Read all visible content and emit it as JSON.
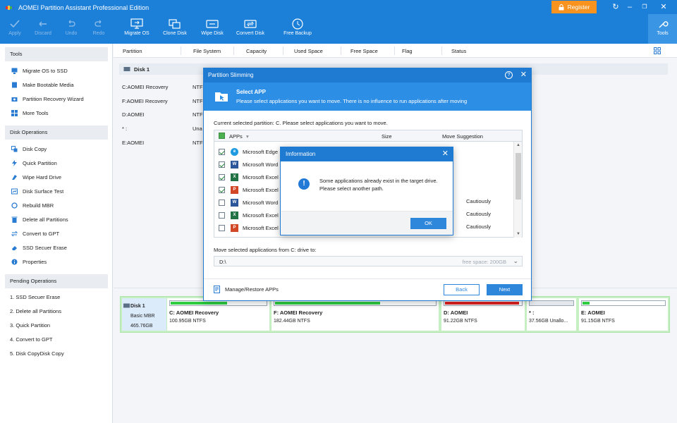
{
  "app": {
    "title": "AOMEI Partition Assistant Professional Edition",
    "register_label": "Register"
  },
  "toolbar": [
    {
      "label": "Apply",
      "icon": "check-icon"
    },
    {
      "label": "Discard",
      "icon": "discard-icon"
    },
    {
      "label": "Undo",
      "icon": "undo-icon"
    },
    {
      "label": "Redo",
      "icon": "redo-icon"
    },
    {
      "label": "Migrate OS",
      "icon": "migrate-os-icon"
    },
    {
      "label": "Clone Disk",
      "icon": "clone-disk-icon"
    },
    {
      "label": "Wipe Disk",
      "icon": "wipe-disk-icon"
    },
    {
      "label": "Convert Disk",
      "icon": "convert-disk-icon"
    },
    {
      "label": "Free Backup",
      "icon": "free-backup-icon"
    },
    {
      "label": "Tools",
      "icon": "wrench-icon"
    }
  ],
  "sidebar": {
    "tools_title": "Tools",
    "tools": [
      "Migrate OS to SSD",
      "Make Bootable Media",
      "Partition Recovery Wizard",
      "More Tools"
    ],
    "disk_ops_title": "Disk Operations",
    "disk_ops": [
      "Disk Copy",
      "Quick Partition",
      "Wipe Hard Drive",
      "Disk Surface Test",
      "Rebuild MBR",
      "Delete all Partitions",
      "Convert to GPT",
      "SSD Secuer Erase",
      "Properties"
    ],
    "pending_title": "Pending Operations",
    "pending": [
      "1. SSD Secuer Erase",
      "2. Delete all Partitions",
      "3. Quick Partition",
      "4. Convert to GPT",
      "5. Disk CopyDisk Copy"
    ]
  },
  "table": {
    "columns": [
      "Partition",
      "File System",
      "Capacity",
      "Used Space",
      "Free Space",
      "Flag",
      "Status"
    ],
    "disk_label": "Disk 1",
    "rows": [
      {
        "partition": "C:AOMEI Recovery",
        "fs": "NTF"
      },
      {
        "partition": "F:AOMEI Recovery",
        "fs": "NTF"
      },
      {
        "partition": "D:AOMEI",
        "fs": "NTF"
      },
      {
        "partition": "* :",
        "fs": "Una"
      },
      {
        "partition": "E:AOMEI",
        "fs": "NTF"
      }
    ]
  },
  "diskmap": {
    "name": "Disk 1",
    "type": "Basic MBR",
    "size": "465.76GB",
    "partitions": [
      {
        "name": "C: AOMEI Recovery",
        "detail": "100.95GB NTFS",
        "used": 0.6,
        "color": "#2ecc40"
      },
      {
        "name": "F: AOMEI Recovery",
        "detail": "182.44GB NTFS",
        "used": 0.66,
        "color": "#2ecc40"
      },
      {
        "name": "D: AOMEI",
        "detail": "91.22GB NTFS",
        "used": 0.97,
        "color": "#e02020"
      },
      {
        "name": "* :",
        "detail": "37.56GB Unallo...",
        "used": 0,
        "color": "#d9dde2"
      },
      {
        "name": "E: AOMEI",
        "detail": "91.15GB NTFS",
        "used": 0.1,
        "color": "#2ecc40"
      }
    ]
  },
  "slimming": {
    "title": "Partition Slimming",
    "banner_title": "Select APP",
    "banner_sub": "Please select applications you want to move. There is no influence to run applications after moving",
    "current": "Current selected partition: C. Please select applications you want to move.",
    "col_apps": "APPs",
    "col_size": "Size",
    "col_move": "Move Suggestion",
    "apps": [
      {
        "name": "Microsoft Edge",
        "checked": true,
        "icon": "edge-icon",
        "suggest": ""
      },
      {
        "name": "Microsoft Word",
        "checked": true,
        "icon": "word-icon",
        "suggest": ""
      },
      {
        "name": "Microsoft Excel",
        "checked": true,
        "icon": "excel-icon",
        "suggest": ""
      },
      {
        "name": "Microsoft Excel",
        "checked": true,
        "icon": "powerpoint-icon",
        "suggest": ""
      },
      {
        "name": "Microsoft Word",
        "checked": false,
        "icon": "word-icon",
        "suggest": "Cautiously"
      },
      {
        "name": "Microsoft Excel",
        "checked": false,
        "icon": "excel-icon",
        "suggest": "Cautiously"
      },
      {
        "name": "Microsoft Excel",
        "checked": false,
        "icon": "powerpoint-icon",
        "suggest": "Cautiously"
      }
    ],
    "move_label": "Move selected applications from C: drive to:",
    "dest_path": "D:\\",
    "free_space": "free space: 200GB",
    "manage": "Manage/Restore APPs",
    "back": "Back",
    "next": "Next"
  },
  "info": {
    "title": "Imformation",
    "line1": "Some applications already exist in the target drive.",
    "line2": "Please select another path.",
    "ok": "OK"
  },
  "colors": {
    "accent": "#1f7ad1",
    "register": "#f7931e",
    "diskmap_bg": "#c6f0c4"
  }
}
